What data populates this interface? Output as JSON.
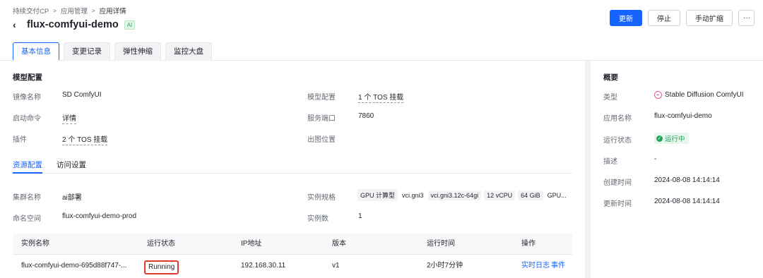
{
  "breadcrumb": [
    "持续交付CP",
    "应用管理",
    "应用详情"
  ],
  "header": {
    "title": "flux-comfyui-demo",
    "badge": "AI",
    "buttons": {
      "update": "更新",
      "stop": "停止",
      "scale": "手动扩缩",
      "more": "···"
    }
  },
  "tabs": [
    "基本信息",
    "变更记录",
    "弹性伸缩",
    "监控大盘"
  ],
  "model_config": {
    "title": "模型配置",
    "image_name_label": "镜像名称",
    "image_name": "SD ComfyUI",
    "model_config_label": "模型配置",
    "model_config_value": "1 个 TOS 挂载",
    "start_cmd_label": "启动命令",
    "start_cmd": "详情",
    "port_label": "服务端口",
    "port": "7860",
    "plugin_label": "插件",
    "plugin": "2 个 TOS 挂载",
    "output_label": "出图位置",
    "output": ""
  },
  "subtabs": [
    "资源配置",
    "访问设置"
  ],
  "resource": {
    "cluster_label": "集群名称",
    "cluster": "ai部署",
    "spec_label": "实例规格",
    "spec_tags": [
      "GPU 计算型",
      "vci.gni3",
      "vci.gni3.12c-64gi",
      "12 vCPU",
      "64 GiB",
      "GPU..."
    ],
    "namespace_label": "命名空间",
    "namespace": "flux-comfyui-demo-prod",
    "count_label": "实例数",
    "count": "1"
  },
  "instances": {
    "headers": [
      "实例名称",
      "运行状态",
      "IP地址",
      "版本",
      "运行时间",
      "操作"
    ],
    "rows": [
      {
        "name": "flux-comfyui-demo-695d88f747-...",
        "status": "Running",
        "ip": "192.168.30.11",
        "version": "v1",
        "uptime": "2小时7分钟",
        "log": "实时日志",
        "event": "事件"
      }
    ]
  },
  "overview": {
    "title": "概要",
    "type_label": "类型",
    "type": "Stable Diffusion ComfyUI",
    "app_label": "应用名称",
    "app": "flux-comfyui-demo",
    "status_label": "运行状态",
    "status": "运行中",
    "desc_label": "描述",
    "desc": "-",
    "created_label": "创建时间",
    "created": "2024-08-08 14:14:14",
    "updated_label": "更新时间",
    "updated": "2024-08-08 14:14:14"
  }
}
